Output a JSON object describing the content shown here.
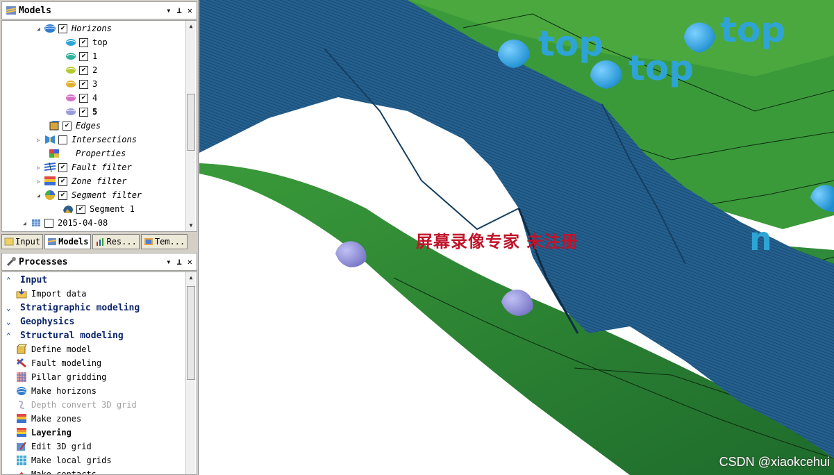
{
  "models_pane": {
    "title": "Models",
    "controls": [
      "▾",
      "⊥",
      "✕"
    ],
    "tree": [
      {
        "label": "Horizons",
        "italic": true,
        "checked": true
      },
      {
        "label": "top",
        "checked": true
      },
      {
        "label": "1",
        "checked": true
      },
      {
        "label": "2",
        "checked": true
      },
      {
        "label": "3",
        "checked": true
      },
      {
        "label": "4",
        "checked": true
      },
      {
        "label": "5",
        "checked": true
      },
      {
        "label": "Edges",
        "italic": true,
        "checked": true
      },
      {
        "label": "Intersections",
        "italic": true,
        "checked": false
      },
      {
        "label": "Properties",
        "italic": true
      },
      {
        "label": "Fault filter",
        "italic": true,
        "checked": true
      },
      {
        "label": "Zone filter",
        "italic": true,
        "checked": true
      },
      {
        "label": "Segment filter",
        "italic": true,
        "checked": true
      },
      {
        "label": "Segment 1",
        "checked": true
      },
      {
        "label": "2015-04-08",
        "checked": false
      }
    ]
  },
  "tabs": [
    "Input",
    "Models",
    "Res...",
    "Tem..."
  ],
  "processes_pane": {
    "title": "Processes",
    "controls": [
      "▾",
      "⊥",
      "✕"
    ],
    "items": [
      {
        "label": "Input",
        "type": "category",
        "expanded": true
      },
      {
        "label": "Import data",
        "type": "item"
      },
      {
        "label": "Stratigraphic modeling",
        "type": "category",
        "expanded": false
      },
      {
        "label": "Geophysics",
        "type": "category",
        "expanded": false
      },
      {
        "label": "Structural modeling",
        "type": "category",
        "expanded": true
      },
      {
        "label": "Define model",
        "type": "item"
      },
      {
        "label": "Fault modeling",
        "type": "item"
      },
      {
        "label": "Pillar gridding",
        "type": "item"
      },
      {
        "label": "Make horizons",
        "type": "item"
      },
      {
        "label": "Depth convert 3D grid",
        "type": "item",
        "disabled": true
      },
      {
        "label": "Make zones",
        "type": "item"
      },
      {
        "label": "Layering",
        "type": "item",
        "bold": true
      },
      {
        "label": "Edit 3D grid",
        "type": "item"
      },
      {
        "label": "Make local grids",
        "type": "item"
      },
      {
        "label": "Make contacts",
        "type": "item"
      }
    ]
  },
  "viewport": {
    "labels": [
      "top",
      "top",
      "top",
      "n"
    ],
    "watermark": "屏幕录像专家 未注册",
    "credit": "CSDN @xiaokcehui",
    "colors": {
      "fault": "#1f5a8a",
      "horizon": "#2f8a3a",
      "marker": "#3aa6e0",
      "marker_lilac": "#8c8cd8"
    }
  }
}
